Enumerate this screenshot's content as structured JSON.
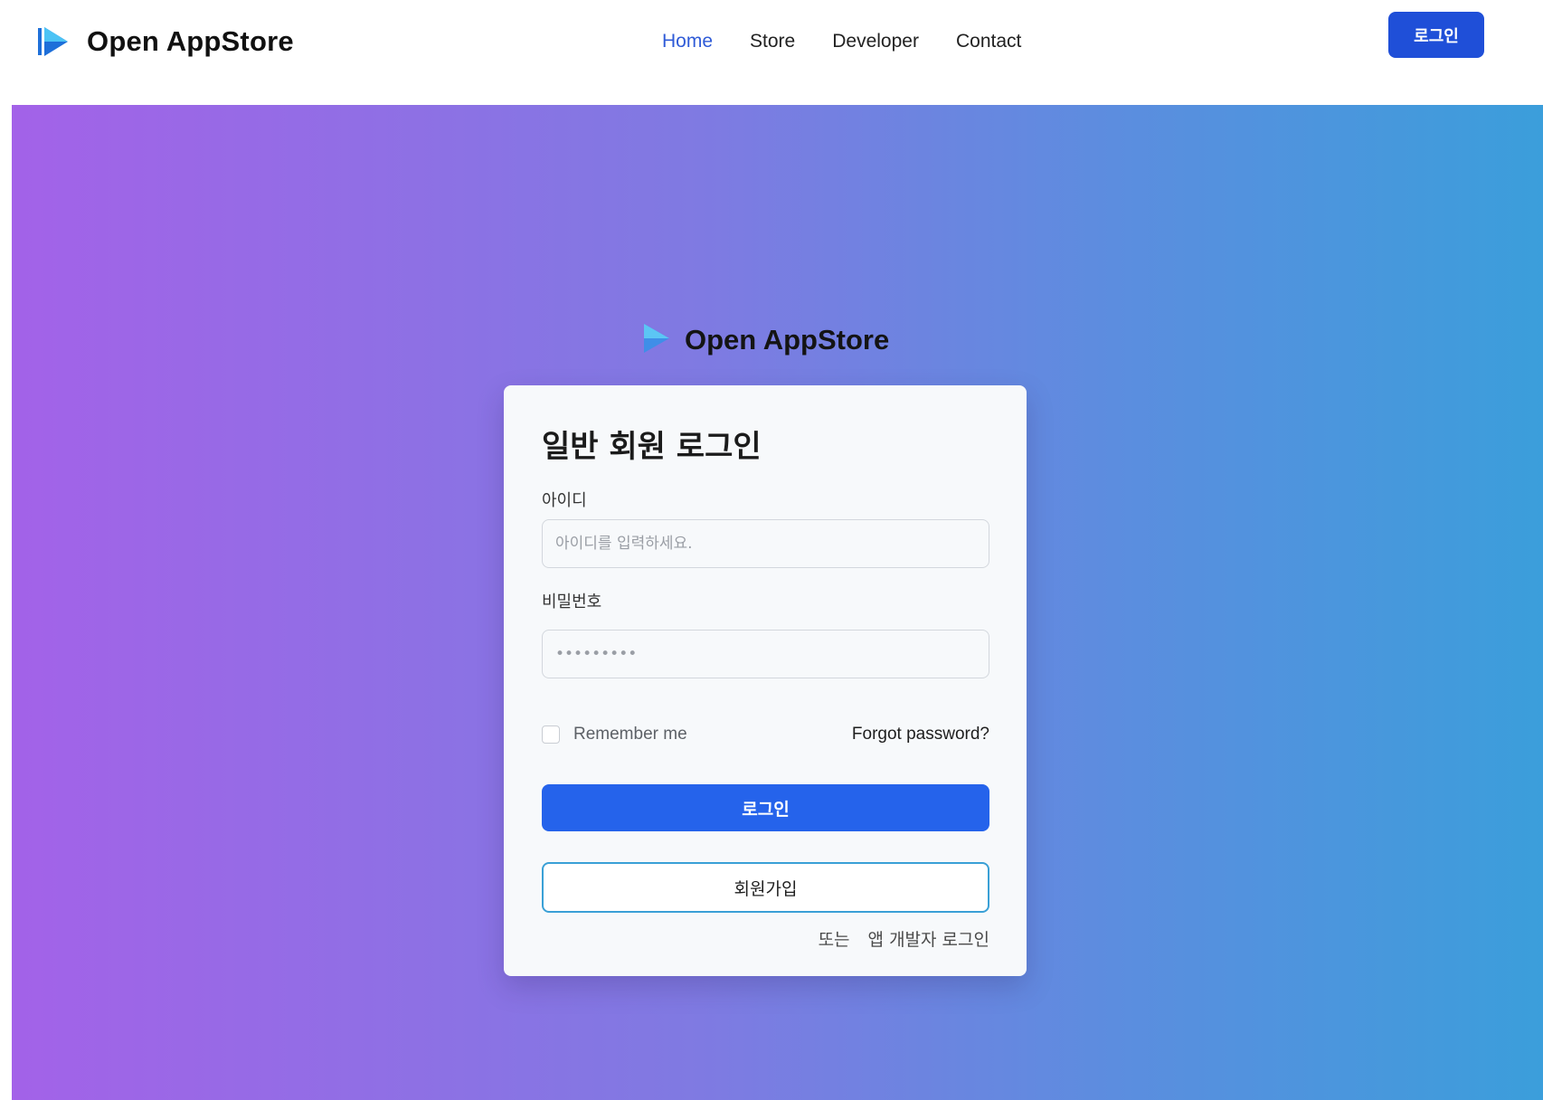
{
  "header": {
    "brand_name": "Open AppStore",
    "nav": [
      {
        "label": "Home",
        "active": true
      },
      {
        "label": "Store",
        "active": false
      },
      {
        "label": "Developer",
        "active": false
      },
      {
        "label": "Contact",
        "active": false
      }
    ],
    "login_label": "로그인"
  },
  "hero": {
    "brand_name": "Open AppStore"
  },
  "login_card": {
    "title": "일반 회원 로그인",
    "id_label": "아이디",
    "id_placeholder": "아이디를 입력하세요.",
    "password_label": "비밀번호",
    "password_placeholder": "•••••••••",
    "remember_label": "Remember me",
    "forgot_label": "Forgot password?",
    "login_button": "로그인",
    "signup_button": "회원가입",
    "or_text": "또는",
    "developer_login": "앱 개발자 로그인"
  },
  "colors": {
    "accent": "#2563eb",
    "header_button": "#1f4fd8",
    "nav_active": "#2f5bd7",
    "gradient_start": "#a362e8",
    "gradient_end": "#3b9edb",
    "logo_dark": "#1e6fd9",
    "logo_light": "#4cc3f5"
  },
  "icons": {
    "logo": "play-triangle-logo-icon"
  }
}
